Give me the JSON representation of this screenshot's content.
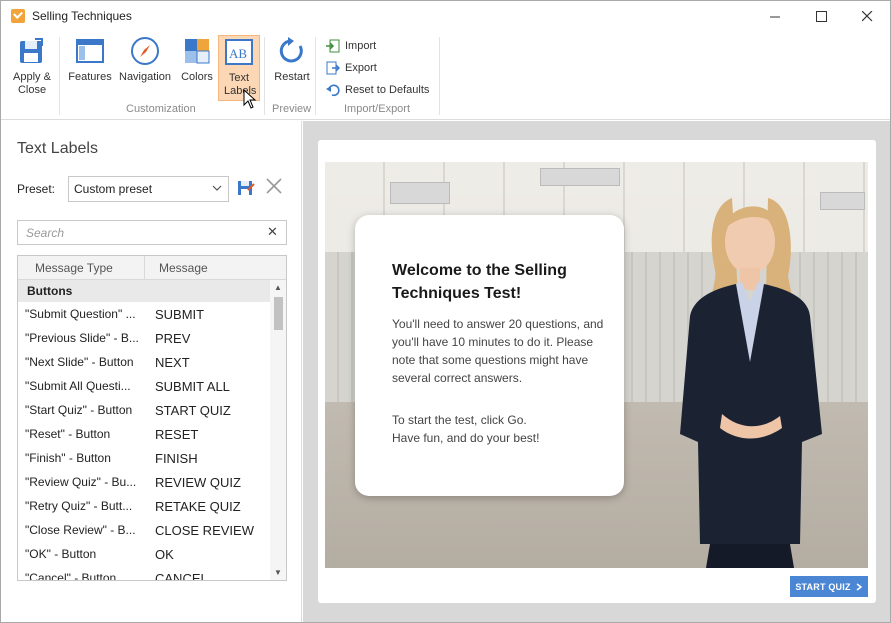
{
  "window": {
    "title": "Selling Techniques"
  },
  "ribbon": {
    "apply_close": "Apply & Close",
    "features": "Features",
    "navigation": "Navigation",
    "colors": "Colors",
    "text_labels": "Text Labels",
    "restart": "Restart",
    "import": "Import",
    "export": "Export",
    "reset_defaults": "Reset to Defaults",
    "group_customization": "Customization",
    "group_preview": "Preview",
    "group_import_export": "Import/Export"
  },
  "panel": {
    "title": "Text Labels",
    "preset_label": "Preset:",
    "preset_value": "Custom preset",
    "search_placeholder": "Search",
    "columns": {
      "type": "Message Type",
      "message": "Message"
    },
    "group": "Buttons",
    "rows": [
      {
        "type": "\"Submit Question\" ...",
        "message": "SUBMIT"
      },
      {
        "type": "\"Previous Slide\" - B...",
        "message": "PREV"
      },
      {
        "type": "\"Next Slide\" - Button",
        "message": "NEXT"
      },
      {
        "type": "\"Submit All Questi...",
        "message": "SUBMIT ALL"
      },
      {
        "type": "\"Start Quiz\" - Button",
        "message": "START QUIZ"
      },
      {
        "type": "\"Reset\" - Button",
        "message": "RESET"
      },
      {
        "type": "\"Finish\" - Button",
        "message": "FINISH"
      },
      {
        "type": "\"Review Quiz\" - Bu...",
        "message": "REVIEW QUIZ"
      },
      {
        "type": "\"Retry Quiz\" - Butt...",
        "message": "RETAKE QUIZ"
      },
      {
        "type": "\"Close Review\" - B...",
        "message": "CLOSE REVIEW"
      },
      {
        "type": "\"OK\" - Button",
        "message": "OK"
      },
      {
        "type": "\"Cancel\" - Button",
        "message": "CANCEL"
      }
    ]
  },
  "preview": {
    "welcome_title": "Welcome to the Selling Techniques Test!",
    "welcome_body": "You'll need to answer 20 questions, and you'll have 10 minutes to do it. Please note that some questions might have several correct answers.",
    "welcome_line1": "To start the test, click Go.",
    "welcome_line2": "Have fun, and do your best!",
    "start_button": "START QUIZ"
  },
  "colors": {
    "accent": "#4a86d4",
    "active_tab": "#fbd7b5",
    "brand_icon": "#f2a33a"
  }
}
